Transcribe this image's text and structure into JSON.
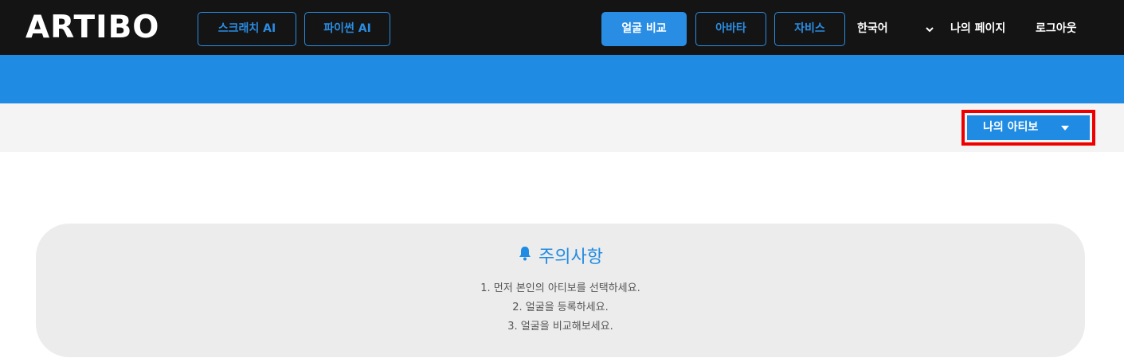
{
  "header": {
    "logo": "ARTIBO",
    "nav_left": [
      {
        "label": "스크래치 AI"
      },
      {
        "label": "파이썬 AI"
      }
    ],
    "nav_right": [
      {
        "label": "얼굴 비교",
        "active": true
      },
      {
        "label": "아바타",
        "active": false
      },
      {
        "label": "자비스",
        "active": false
      }
    ],
    "language": "한국어",
    "my_page": "나의 페이지",
    "logout": "로그아웃"
  },
  "toolbar": {
    "my_artibo_label": "나의 아티보"
  },
  "notice": {
    "icon": "bell-icon",
    "title": "주의사항",
    "lines": [
      "1. 먼저 본인의 아티보를 선택하세요.",
      "2. 얼굴을 등록하세요.",
      "3. 얼굴을 비교해보세요."
    ]
  },
  "colors": {
    "header_bg": "#141414",
    "accent": "#1f8be3",
    "highlight": "#ee0000",
    "subbar_bg": "#f4f4f4",
    "notice_bg": "#ececec"
  }
}
